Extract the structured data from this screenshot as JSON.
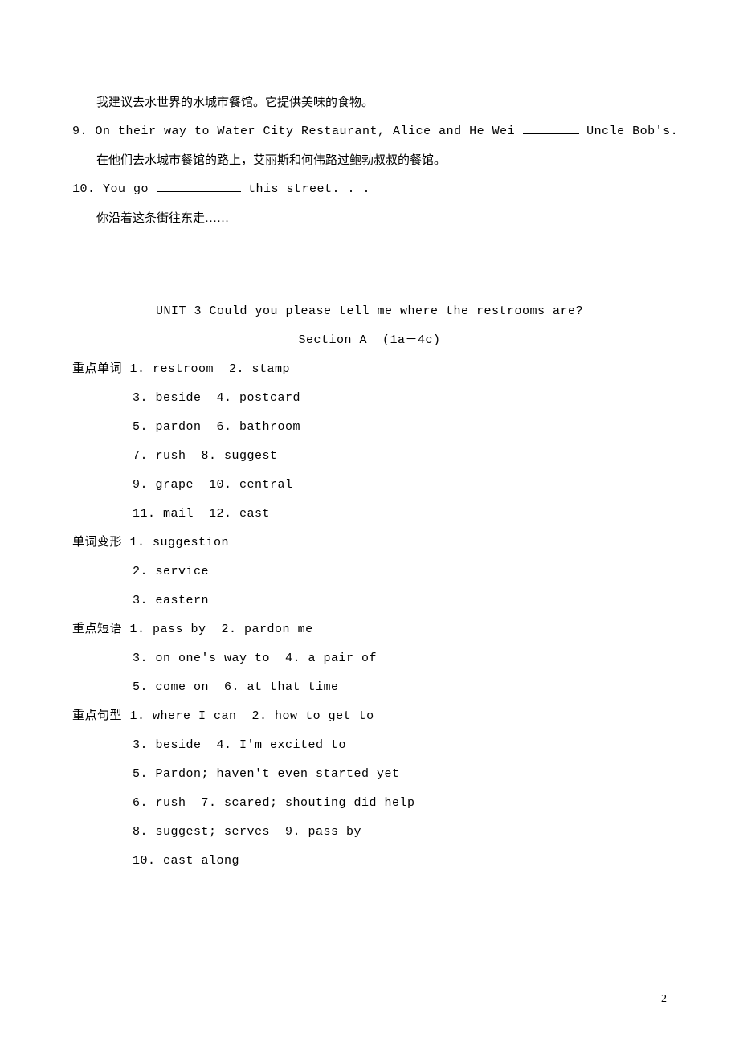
{
  "top_lines": {
    "l1_cn": "我建议去水世界的水城市餐馆。它提供美味的食物。",
    "q9_pre": "9. On their way to Water City Restaurant, Alice and He Wei ",
    "q9_post": " Uncle Bob's.",
    "q9_cn": "在他们去水城市餐馆的路上，艾丽斯和何伟路过鲍勃叔叔的餐馆。",
    "q10_pre": "10. You go ",
    "q10_post": " this street. . .",
    "q10_cn": "你沿着这条街往东走……"
  },
  "title": {
    "unit": "UNIT 3 Could you please tell me where the restrooms are?",
    "section": "Section A  (1a－4c)"
  },
  "sections": {
    "vocab_label": "重点单词",
    "vocab_items": [
      "1. restroom  2. stamp",
      "3. beside  4. postcard",
      "5. pardon  6. bathroom",
      "7. rush  8. suggest",
      "9. grape  10. central",
      "11. mail  12. east"
    ],
    "form_label": "单词变形",
    "form_items": [
      "1. suggestion",
      "2. service",
      "3. eastern"
    ],
    "phrase_label": "重点短语",
    "phrase_items": [
      "1. pass by  2. pardon me",
      "3. on one's way to  4. a pair of",
      "5. come on  6. at that time"
    ],
    "sentence_label": "重点句型",
    "sentence_items": [
      "1. where I can  2. how to get to",
      "3. beside  4. I'm excited to",
      "5. Pardon; haven't even started yet",
      "6. rush  7. scared; shouting did help",
      "8. suggest; serves  9. pass by",
      "10. east along"
    ]
  },
  "page_number": "2"
}
